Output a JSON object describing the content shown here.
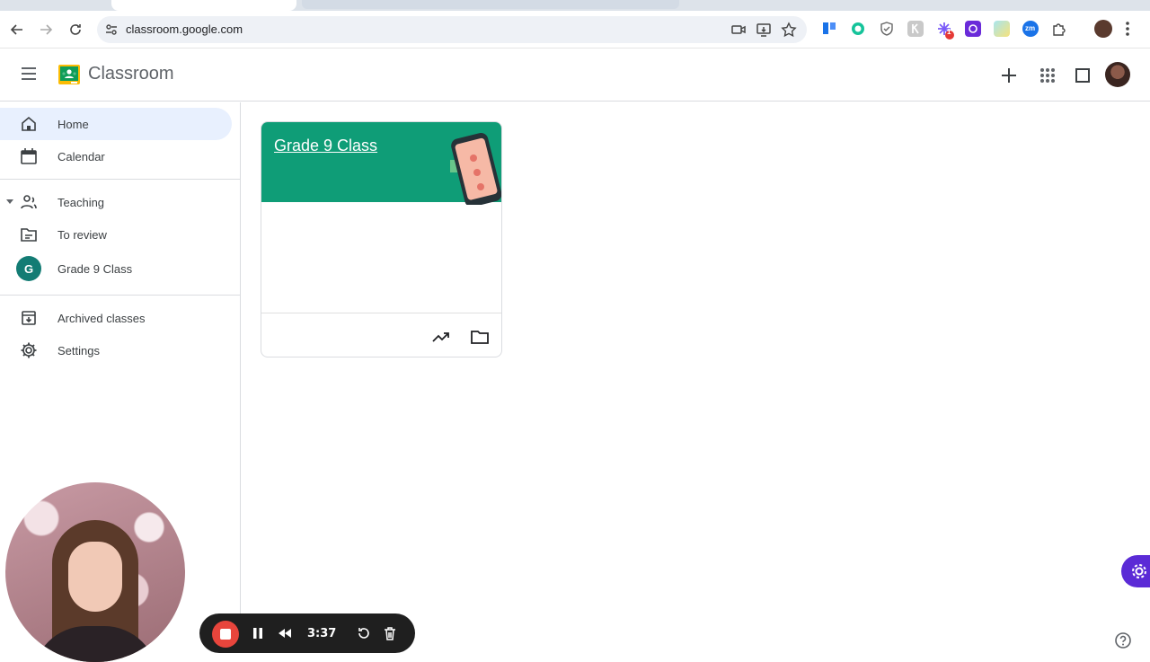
{
  "browser": {
    "url": "classroom.google.com",
    "extension_badge_count": "1",
    "zm_label": "zm"
  },
  "app": {
    "title": "Classroom"
  },
  "sidebar": {
    "items": [
      {
        "label": "Home",
        "icon": "home-icon"
      },
      {
        "label": "Calendar",
        "icon": "calendar-icon"
      },
      {
        "label": "Teaching",
        "icon": "people-icon"
      },
      {
        "label": "To review",
        "icon": "review-icon"
      },
      {
        "label": "Grade 9 Class",
        "icon": "class-avatar",
        "avatar_letter": "G"
      },
      {
        "label": "Archived classes",
        "icon": "archive-icon"
      },
      {
        "label": "Settings",
        "icon": "gear-icon"
      }
    ]
  },
  "card": {
    "title": "Grade 9 Class",
    "banner_color": "#0f9d77"
  },
  "recorder": {
    "time": "3:37"
  },
  "colors": {
    "active_nav": "#e8f0fe",
    "class_avatar": "#137c74",
    "record_red": "#e8453c",
    "floating_gear": "#5b2bd6"
  }
}
